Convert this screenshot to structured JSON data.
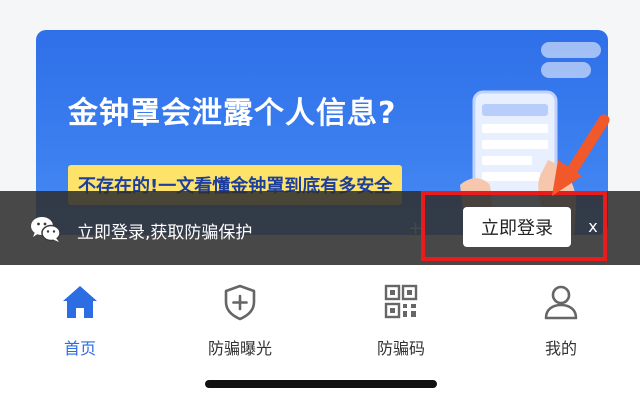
{
  "banner": {
    "title": "金钟罩会泄露个人信息?",
    "subtitle": "不存在的!一文看懂金钟罩到底有多安全"
  },
  "login_prompt": {
    "text": "立即登录,获取防骗保护",
    "button_label": "立即登录",
    "close_label": "x"
  },
  "nav": {
    "items": [
      {
        "label": "首页",
        "icon": "home-icon",
        "active": true
      },
      {
        "label": "防骗曝光",
        "icon": "shield-plus-icon",
        "active": false
      },
      {
        "label": "防骗码",
        "icon": "qr-code-icon",
        "active": false
      },
      {
        "label": "我的",
        "icon": "user-icon",
        "active": false
      }
    ]
  },
  "colors": {
    "accent": "#2c6de4",
    "banner_blue": "#3b7ff0",
    "highlight": "#fde36a",
    "annotation_red": "#e81c1c",
    "annotation_orange": "#f2592a"
  }
}
